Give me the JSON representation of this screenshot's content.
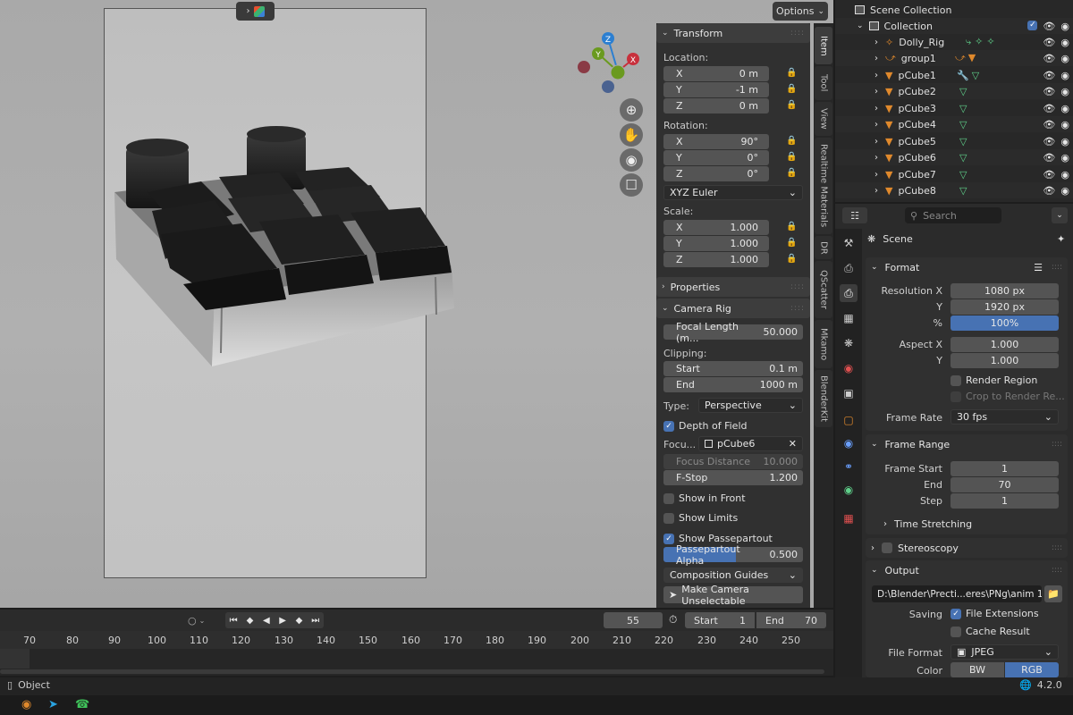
{
  "viewport": {
    "options_label": "Options",
    "gizmo": {
      "x": "X",
      "y": "Y",
      "z": "Z"
    }
  },
  "npanel": {
    "transform": {
      "title": "Transform",
      "location_label": "Location:",
      "location": {
        "x": "0 m",
        "y": "-1 m",
        "z": "0 m"
      },
      "rotation_label": "Rotation:",
      "rotation": {
        "x": "90°",
        "y": "0°",
        "z": "0°"
      },
      "rotation_mode": "XYZ Euler",
      "scale_label": "Scale:",
      "scale": {
        "x": "1.000",
        "y": "1.000",
        "z": "1.000"
      },
      "axis": {
        "x": "X",
        "y": "Y",
        "z": "Z"
      }
    },
    "properties_title": "Properties",
    "camera_rig": {
      "title": "Camera Rig",
      "focal_label": "Focal Length (m...",
      "focal_value": "50.000",
      "clipping_label": "Clipping:",
      "start_label": "Start",
      "start_value": "0.1 m",
      "end_label": "End",
      "end_value": "1000 m",
      "type_label": "Type:",
      "type_value": "Perspective",
      "dof_label": "Depth of Field",
      "focus_label": "Focu...",
      "focus_object": "pCube6",
      "focus_distance_label": "Focus Distance",
      "focus_distance_value": "10.000",
      "fstop_label": "F-Stop",
      "fstop_value": "1.200",
      "show_in_front": "Show in Front",
      "show_limits": "Show Limits",
      "show_passepartout": "Show Passepartout",
      "passepartout_label": "Passepartout Alpha",
      "passepartout_value": "0.500",
      "passepartout_level": 0.5,
      "composition_guides": "Composition Guides",
      "make_unselectable": "Make Camera Unselectable"
    }
  },
  "vtabs": [
    "Item",
    "Tool",
    "View",
    "Realtime Materials",
    "DR",
    "QScatter",
    "Mkamo",
    "BlenderKit"
  ],
  "outliner": {
    "scene_collection": "Scene Collection",
    "collection": "Collection",
    "items": [
      {
        "name": "Dolly_Rig"
      },
      {
        "name": "group1"
      },
      {
        "name": "pCube1"
      },
      {
        "name": "pCube2"
      },
      {
        "name": "pCube3"
      },
      {
        "name": "pCube4"
      },
      {
        "name": "pCube5"
      },
      {
        "name": "pCube6"
      },
      {
        "name": "pCube7"
      },
      {
        "name": "pCube8"
      }
    ]
  },
  "properties": {
    "search_placeholder": "Search",
    "context": "Scene",
    "format": {
      "title": "Format",
      "res_x_label": "Resolution X",
      "res_x": "1080 px",
      "res_y_label": "Y",
      "res_y": "1920 px",
      "pct_label": "%",
      "pct": "100%",
      "aspect_x_label": "Aspect X",
      "aspect_x": "1.000",
      "aspect_y_label": "Y",
      "aspect_y": "1.000",
      "render_region": "Render Region",
      "crop_region": "Crop to Render Re...",
      "frame_rate_label": "Frame Rate",
      "frame_rate": "30 fps"
    },
    "frame_range": {
      "title": "Frame Range",
      "start_label": "Frame Start",
      "start": "1",
      "end_label": "End",
      "end": "70",
      "step_label": "Step",
      "step": "1"
    },
    "time_stretching": "Time Stretching",
    "stereoscopy": "Stereoscopy",
    "output": {
      "title": "Output",
      "path": "D:\\Blender\\Precti...eres\\PNg\\anim 1\\",
      "saving_label": "Saving",
      "file_extensions": "File Extensions",
      "cache_result": "Cache Result",
      "file_format_label": "File Format",
      "file_format": "JPEG",
      "color_label": "Color",
      "color_bw": "BW",
      "color_rgb": "RGB"
    }
  },
  "timeline": {
    "current_frame": "55",
    "start_label": "Start",
    "start": "1",
    "end_label": "End",
    "end": "70",
    "ticks": [
      "70",
      "80",
      "90",
      "100",
      "110",
      "120",
      "130",
      "140",
      "150",
      "160",
      "170",
      "180",
      "190",
      "200",
      "210",
      "220",
      "230",
      "240",
      "250"
    ]
  },
  "statusbar": {
    "mode": "Object",
    "version": "4.2.0"
  },
  "colors": {
    "accent_blue": "#4772b3",
    "x_axis": "#c8303c",
    "y_axis": "#6a9a1f",
    "z_axis": "#2c7fd1",
    "mesh_orange": "#e0892c",
    "mesh_green": "#5fd08a"
  }
}
